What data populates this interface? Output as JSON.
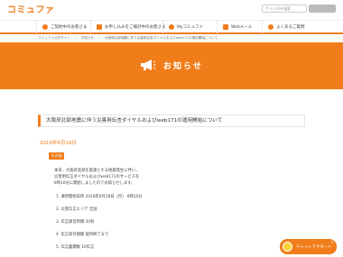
{
  "header": {
    "logo_text": "コミュファ",
    "logo_sub": "",
    "search_placeholder": "サイト内を検索"
  },
  "gnav": {
    "items": [
      {
        "label": "ご契約中のお客さま"
      },
      {
        "label": "お申し込みをご検討中のお客さま"
      },
      {
        "label": "Myコミュファ"
      },
      {
        "label": "Webメール"
      },
      {
        "label": "よくあるご質問"
      }
    ]
  },
  "breadcrumb": [
    "コミュファ公式サイト",
    "お知らせ",
    "大阪府北部地震に伴う災害用伝言ダイヤルおよびweb171の運用開始について"
  ],
  "hero": {
    "title": "お知らせ",
    "icon": "megaphone-icon"
  },
  "article": {
    "title": "大阪府北部地震に伴う災害用伝言ダイヤルおよびweb171の運用開始について",
    "date": "2018年6月18日",
    "tag": "その他",
    "lines": [
      "本日、大阪府北部を震源とする地震発生に伴い、",
      "災害用伝言ダイヤルおよびweb171のサービスを",
      "8時10分に開始しましたのでお知らせします。",
      "1.  運用開始日時 2018年6月18日（月） 8時10分",
      "2.  災害伝言エリア          全国",
      "3.  伝言録音時間          30秒",
      "4.  伝言保存期間          提供終了まで",
      "5.  伝言蓄積数     10伝言"
    ]
  },
  "chat": {
    "label": "チャットでサポート",
    "close": "×"
  },
  "colors": {
    "accent": "#f07d1a"
  }
}
